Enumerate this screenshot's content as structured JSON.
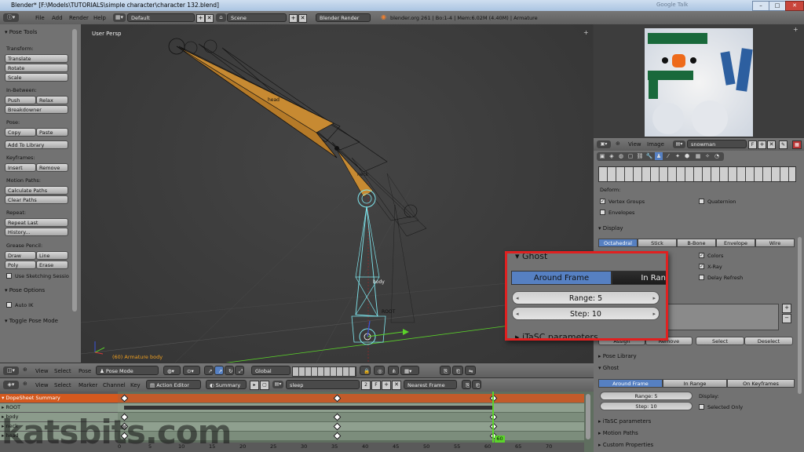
{
  "title_bar": {
    "title": "Blender* [F:\\Models\\TUTORIALS\\simple character\\character 132.blend]",
    "right_ghost": "Google Talk"
  },
  "info_header": {
    "menus": [
      "File",
      "Add",
      "Render",
      "Help"
    ],
    "screen": "Default",
    "scene": "Scene",
    "engine": "Blender Render",
    "stats": "blender.org 261 | Bo:1-4 | Mem:6.02M (4.40M) | Armature"
  },
  "toolshelf": {
    "panel_title": "Pose Tools",
    "transform_label": "Transform:",
    "translate": "Translate",
    "rotate": "Rotate",
    "scale": "Scale",
    "inbetween_label": "In-Between:",
    "push": "Push",
    "relax": "Relax",
    "breakdowner": "Breakdowner",
    "pose_label": "Pose:",
    "copy": "Copy",
    "paste": "Paste",
    "add_to_library": "Add To Library",
    "keyframes_label": "Keyframes:",
    "insert": "Insert",
    "remove": "Remove",
    "motion_paths_label": "Motion Paths:",
    "calculate_paths": "Calculate Paths",
    "clear_paths": "Clear Paths",
    "repeat_label": "Repeat:",
    "repeat_last": "Repeat Last",
    "history": "History...",
    "grease_label": "Grease Pencil:",
    "draw": "Draw",
    "line": "Line",
    "poly": "Poly",
    "erase": "Erase",
    "use_sketching": "Use Sketching Sessio",
    "pose_options": "Pose Options",
    "auto_ik": "Auto IK",
    "toggle_pose_mode": "Toggle Pose Mode"
  },
  "viewport": {
    "view_label": "User Persp",
    "bone_head": "head",
    "bone_neck": "neck",
    "bone_body": "body",
    "bone_root": "ROOT",
    "status": "(60) Armature body"
  },
  "viewport_header": {
    "menus": [
      "View",
      "Select",
      "Pose"
    ],
    "mode": "Pose Mode",
    "orientation": "Global"
  },
  "uv_editor": {
    "menus": [
      "View",
      "Image"
    ],
    "image_name": "snowman",
    "f_label": "F"
  },
  "properties": {
    "deform_label": "Deform:",
    "vertex_groups": "Vertex Groups",
    "envelopes": "Envelopes",
    "quaternion": "Quaternion",
    "display_title": "Display",
    "display_options": [
      "Octahedral",
      "Stick",
      "B-Bone",
      "Envelope",
      "Wire"
    ],
    "colors": "Colors",
    "xray": "X-Ray",
    "delay_refresh": "Delay Refresh",
    "assign": "Assign",
    "remove": "Remove",
    "select": "Select",
    "deselect": "Deselect",
    "pose_library": "Pose Library",
    "ghost_title": "Ghost",
    "ghost_options": [
      "Around Frame",
      "In Range",
      "On Keyframes"
    ],
    "range": "Range: 5",
    "step": "Step: 10",
    "display_label": "Display:",
    "selected_only": "Selected Only",
    "itasc": "iTaSC parameters",
    "motion_paths": "Motion Paths",
    "custom_properties": "Custom Properties"
  },
  "zoom_callout": {
    "ghost_title": "Ghost",
    "around_frame": "Around Frame",
    "in_range": "In Ran",
    "range": "Range: 5",
    "step": "Step: 10",
    "itasc": "iTaSC parameters",
    "border_color": "#e02020"
  },
  "dopesheet_header": {
    "menus": [
      "View",
      "Select",
      "Marker",
      "Channel",
      "Key"
    ],
    "mode": "Action Editor",
    "summary": "Summary",
    "action": "sleep",
    "users": "2",
    "f_label": "F",
    "snap": "Nearest Frame"
  },
  "dopesheet": {
    "channels": [
      "DopeSheet Summary",
      "ROOT",
      "body",
      "neck",
      "head"
    ],
    "ticks": [
      "0",
      "5",
      "10",
      "15",
      "20",
      "25",
      "30",
      "35",
      "40",
      "45",
      "50",
      "55",
      "60",
      "65",
      "70"
    ],
    "current_frame": "60",
    "summary_color": "#d4591e"
  },
  "watermark": "katsbits.com"
}
